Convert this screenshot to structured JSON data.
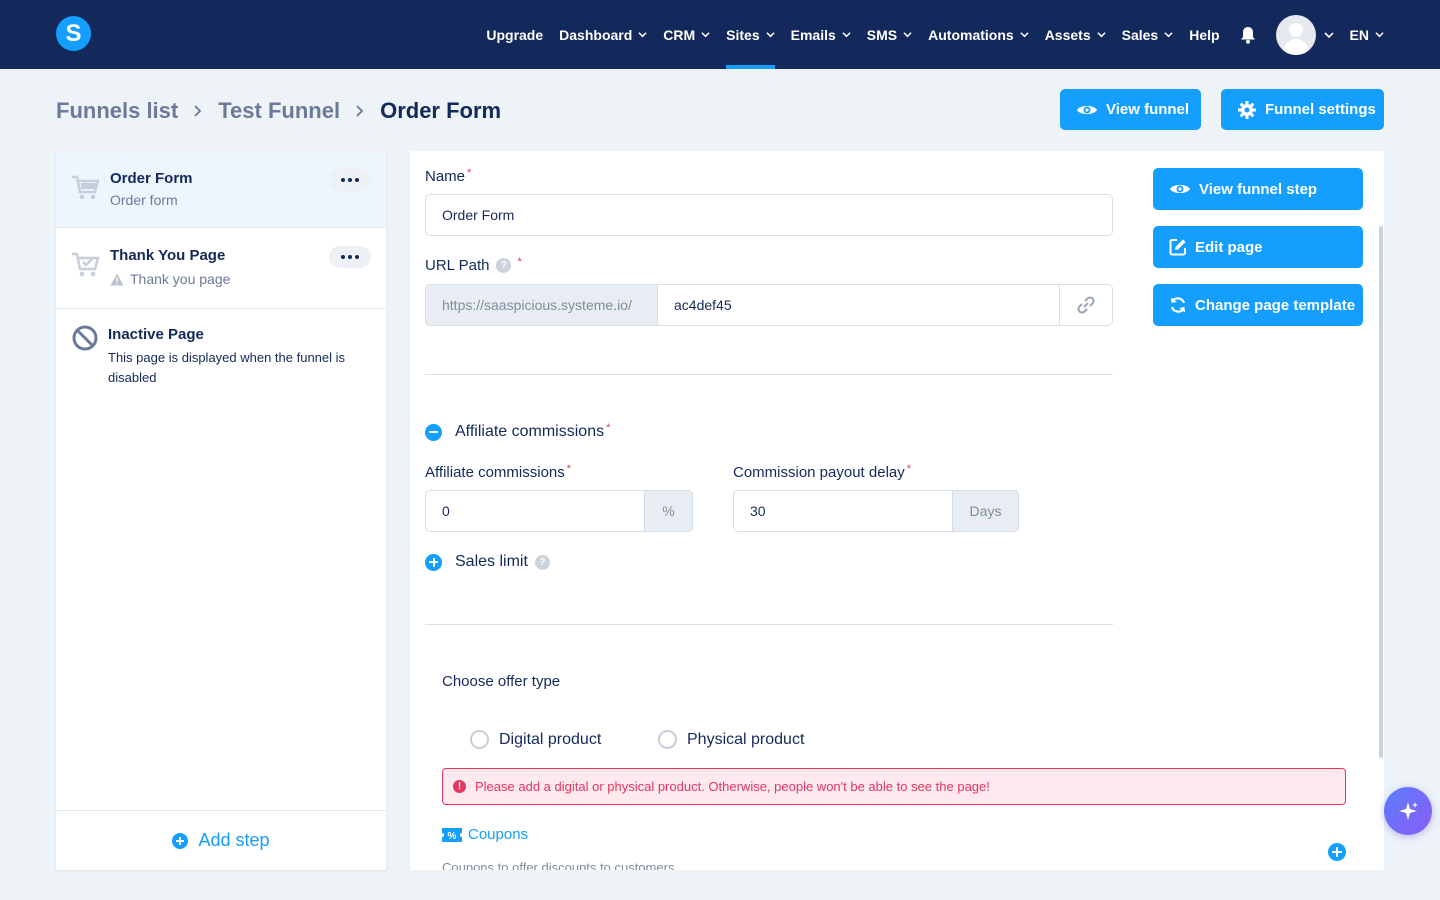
{
  "nav": {
    "logo_letter": "S",
    "items": [
      {
        "label": "Upgrade",
        "chevron": false
      },
      {
        "label": "Dashboard",
        "chevron": true
      },
      {
        "label": "CRM",
        "chevron": true
      },
      {
        "label": "Sites",
        "chevron": true,
        "active": true
      },
      {
        "label": "Emails",
        "chevron": true
      },
      {
        "label": "SMS",
        "chevron": true
      },
      {
        "label": "Automations",
        "chevron": true
      },
      {
        "label": "Assets",
        "chevron": true
      },
      {
        "label": "Sales",
        "chevron": true
      },
      {
        "label": "Help",
        "chevron": false
      }
    ],
    "language": "EN"
  },
  "breadcrumb": {
    "items": [
      "Funnels list",
      "Test Funnel"
    ],
    "current": "Order Form"
  },
  "header_buttons": {
    "view_funnel": "View funnel",
    "funnel_settings": "Funnel settings"
  },
  "sidebar": {
    "steps": [
      {
        "title": "Order Form",
        "subtitle": "Order form"
      },
      {
        "title": "Thank You Page",
        "subtitle": "Thank you page"
      },
      {
        "title": "Inactive Page",
        "subtitle": "This page is displayed when the funnel is disabled"
      }
    ],
    "add_step": "Add step"
  },
  "form": {
    "name_label": "Name",
    "name_value": "Order Form",
    "url_label": "URL Path",
    "url_prefix": "https://saaspicious.systeme.io/",
    "url_value": "ac4def45",
    "affiliate_toggle": "Affiliate commissions",
    "affiliate_label": "Affiliate commissions",
    "affiliate_value": "0",
    "affiliate_unit": "%",
    "payout_label": "Commission payout delay",
    "payout_value": "30",
    "payout_unit": "Days",
    "sales_limit": "Sales limit",
    "offer_type_label": "Choose offer type",
    "offer_options": [
      "Digital product",
      "Physical product"
    ],
    "alert": "Please add a digital or physical product. Otherwise, people won't be able to see the page!",
    "coupons_label": "Coupons",
    "coupons_desc": "Coupons to offer discounts to customers"
  },
  "side_buttons": {
    "view_step": "View funnel step",
    "edit_page": "Edit page",
    "change_template": "Change page template"
  },
  "colors": {
    "nav_bg": "#14295b",
    "primary": "#149efe",
    "error": "#e5365f",
    "page_bg": "#eef3f8"
  }
}
